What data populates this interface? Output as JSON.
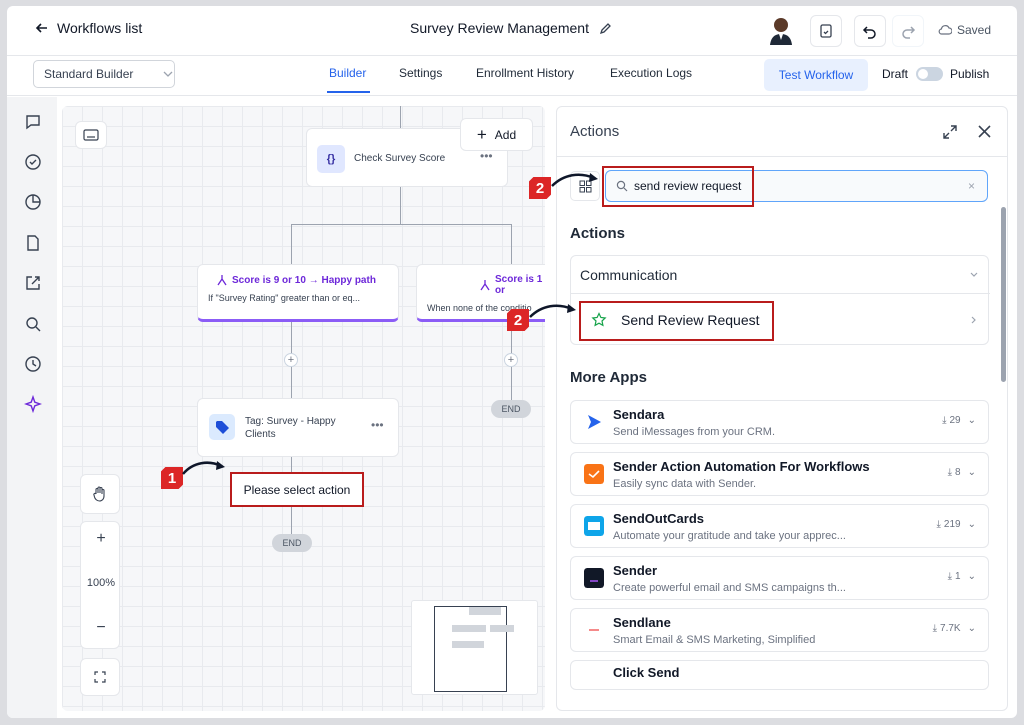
{
  "header": {
    "back_label": "Workflows list",
    "workflow_title": "Survey Review Management",
    "saved_label": "Saved"
  },
  "subheader": {
    "builder_select": "Standard Builder",
    "tabs": [
      {
        "label": "Builder",
        "active": true
      },
      {
        "label": "Settings",
        "active": false
      },
      {
        "label": "Enrollment History",
        "active": false
      },
      {
        "label": "Execution Logs",
        "active": false
      }
    ],
    "test_workflow": "Test Workflow",
    "draft_label": "Draft",
    "publish_label": "Publish"
  },
  "rail_icons": [
    "chat-icon",
    "check-circle-icon",
    "pie-chart-icon",
    "file-icon",
    "external-link-icon",
    "search-icon",
    "history-icon",
    "sparkle-icon"
  ],
  "canvas": {
    "add_label": "Add",
    "check_node": "Check Survey Score",
    "check_node_icon": "{}",
    "branch_left_title": "Score is 9 or 10 → Happy path",
    "branch_left_sub": "If \"Survey Rating\" greater than or eq...",
    "branch_right_title": "Score is 1 or",
    "branch_right_sub": "When none of the conditio",
    "tag_node": "Tag: Survey - Happy Clients",
    "select_action": "Please select action",
    "end_label": "END",
    "zoom": "100%",
    "callout_1": "1",
    "callout_2": "2"
  },
  "panel": {
    "title": "Actions",
    "search_value": "send review request",
    "actions_heading": "Actions",
    "category": "Communication",
    "action_item": "Send Review Request",
    "more_apps_heading": "More Apps",
    "apps": [
      {
        "name": "Sendara",
        "desc": "Send iMessages from your CRM.",
        "count": "29",
        "color": "#2563eb"
      },
      {
        "name": "Sender Action Automation For Workflows",
        "desc": "Easily sync data with Sender.",
        "count": "8",
        "color": "#f97316"
      },
      {
        "name": "SendOutCards",
        "desc": "Automate your gratitude and take your apprec...",
        "count": "219",
        "color": "#0ea5e9"
      },
      {
        "name": "Sender",
        "desc": "Create powerful email and SMS campaigns th...",
        "count": "1",
        "color": "#111827"
      },
      {
        "name": "Sendlane",
        "desc": "Smart Email & SMS Marketing, Simplified",
        "count": "7.7K",
        "color": "#ef4444"
      },
      {
        "name": "Click Send",
        "desc": "",
        "count": "",
        "color": "#6b7280"
      }
    ]
  },
  "colors": {
    "accent": "#2563eb",
    "branch": "#6d28d9",
    "highlight_box": "#b91c1c"
  }
}
